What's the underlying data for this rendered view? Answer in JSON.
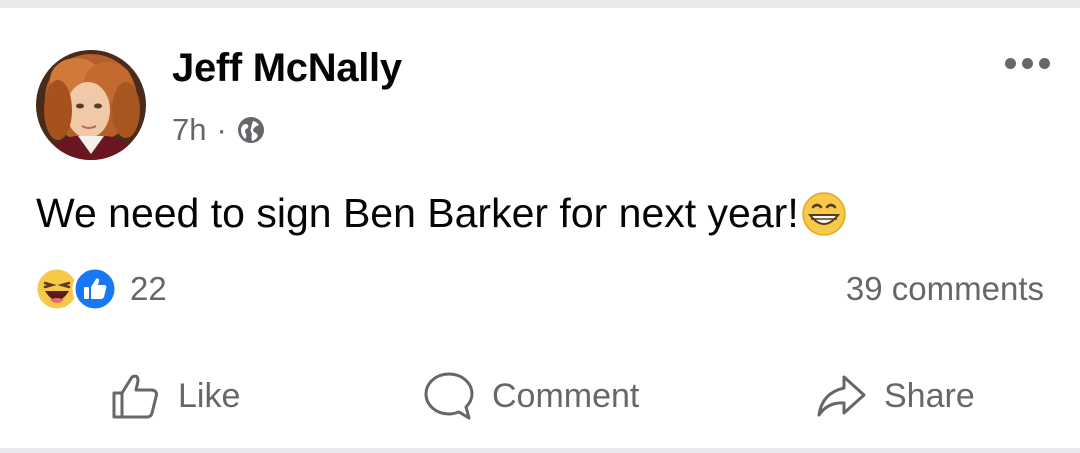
{
  "post": {
    "author": "Jeff McNally",
    "time": "7h",
    "separator": "·",
    "privacy_icon": "globe-icon",
    "text": "We need to sign Ben Barker for next year!",
    "text_emoji": "grinning-face-emoji"
  },
  "reactions": {
    "icons": [
      "haha-reaction-icon",
      "like-reaction-icon"
    ],
    "count": "22",
    "comments": "39 comments"
  },
  "actions": {
    "like": "Like",
    "comment": "Comment",
    "share": "Share"
  },
  "colors": {
    "text": "#050505",
    "secondary": "#65676b",
    "like_blue": "#1877f2",
    "emoji_yellow": "#f7c948"
  }
}
